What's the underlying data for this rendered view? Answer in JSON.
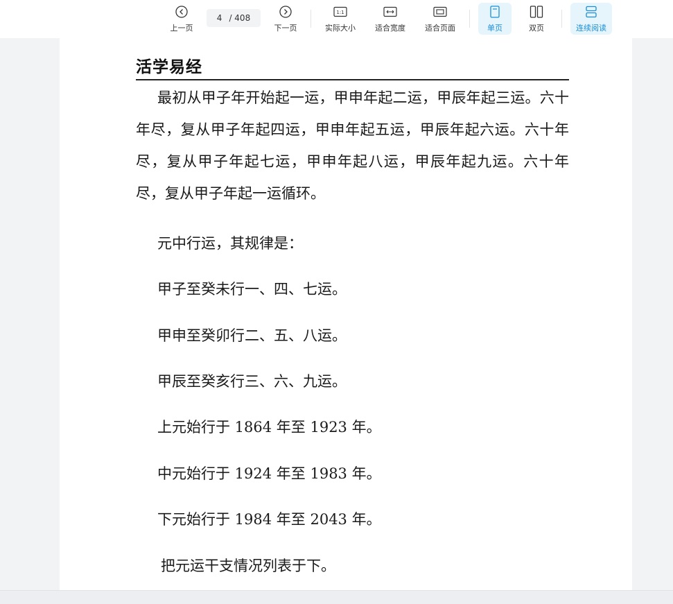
{
  "toolbar": {
    "prev_label": "上一页",
    "current_page": "4",
    "total_pages": "/ 408",
    "next_label": "下一页",
    "actual_size_label": "实际大小",
    "actual_size_icon_text": "1:1",
    "fit_width_label": "适合宽度",
    "fit_page_label": "适合页面",
    "single_page_label": "单页",
    "double_page_label": "双页",
    "continuous_label": "连续阅读",
    "accent_color": "#1a8fd6",
    "active_bg": "#e6f4fb"
  },
  "document": {
    "title": "活学易经",
    "paragraph": "最初从甲子年开始起一运，甲申年起二运，甲辰年起三运。六十年尽，复从甲子年起四运，甲申年起五运，甲辰年起六运。六十年尽，复从甲子年起七运，甲申年起八运，甲辰年起九运。六十年尽，复从甲子年起一运循环。",
    "lines": [
      "元中行运，其规律是：",
      "甲子至癸未行一、四、七运。",
      "甲申至癸卯行二、五、八运。",
      "甲辰至癸亥行三、六、九运。",
      "上元始行于 1864 年至 1923 年。",
      "中元始行于 1924 年至 1983 年。",
      "下元始行于 1984 年至 2043 年。",
      "把元运干支情况列表于下。"
    ]
  }
}
